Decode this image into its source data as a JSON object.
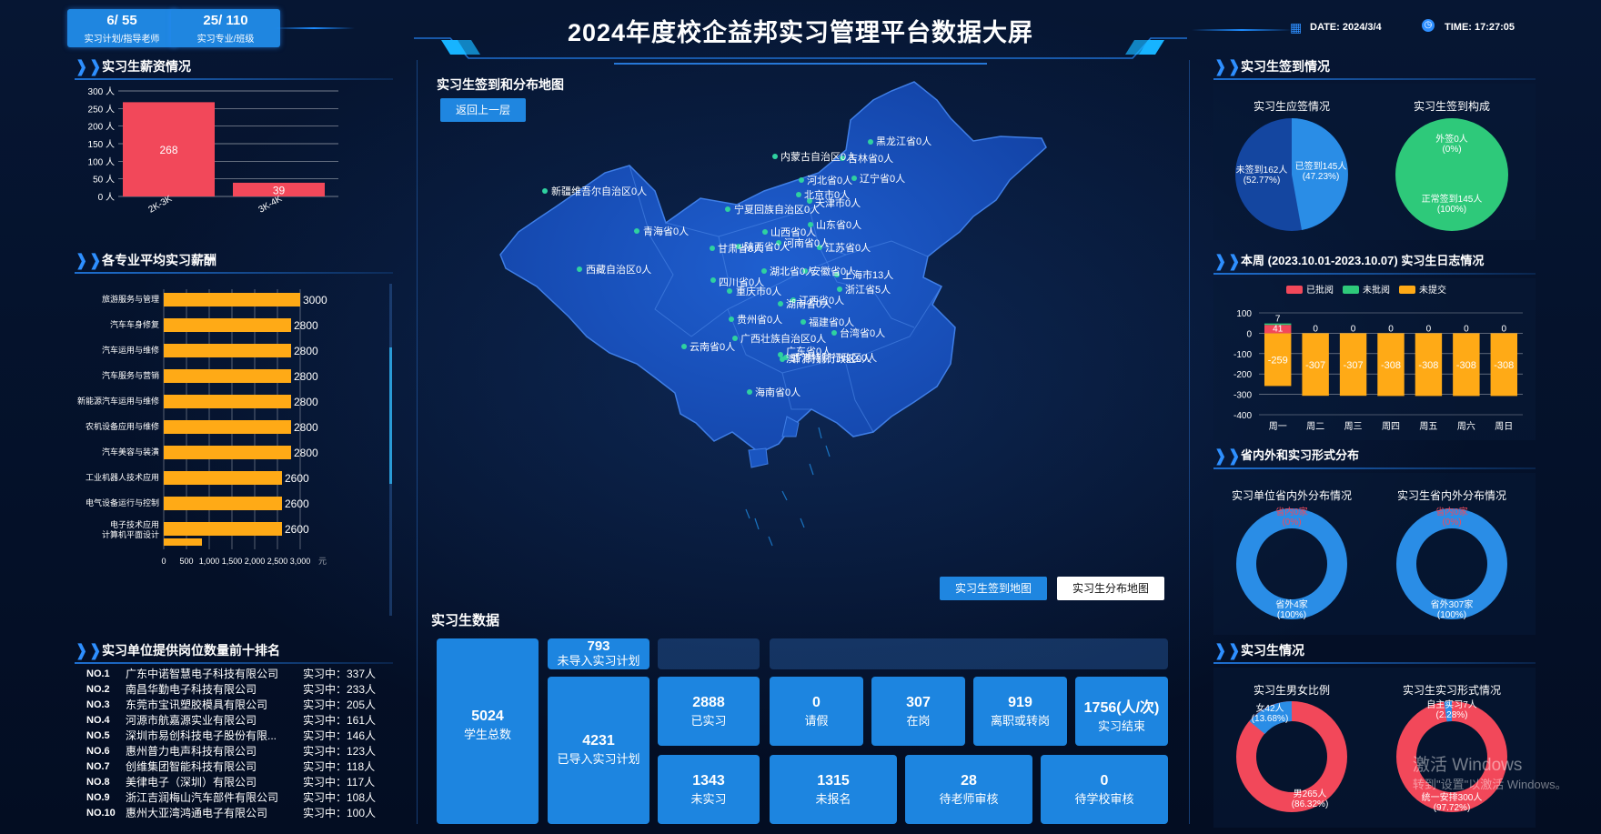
{
  "header": {
    "title": "2024年度校企益邦实习管理平台数据大屏",
    "stats": [
      {
        "value": "6/ 55",
        "label": "实习计划/指导老师"
      },
      {
        "value": "25/ 110",
        "label": "实习专业/班级"
      }
    ],
    "date": "DATE:  2024/3/4",
    "time": "TIME:  17:27:05",
    "colors": {
      "accent": "#1f86e0",
      "bg": "#04122b"
    }
  },
  "salary": {
    "title": "实习生薪资情况",
    "chart_data": {
      "type": "bar",
      "categories": [
        "2K-3K",
        "3K-4K"
      ],
      "values": [
        268,
        39
      ],
      "yticks": [
        "300 人",
        "250 人",
        "200 人",
        "150 人",
        "100 人",
        "50 人",
        "0 人"
      ],
      "ylim": [
        0,
        300
      ],
      "color": "#f2485a"
    }
  },
  "major_salary": {
    "title": "各专业平均实习薪酬",
    "unit": "元",
    "chart_data": {
      "type": "bar",
      "orientation": "horizontal",
      "categories": [
        "旅游服务与管理",
        "汽车车身修复",
        "汽车运用与维修",
        "汽车服务与营销",
        "新能源汽车运用与维修",
        "农机设备应用与维修",
        "汽车美容与装潢",
        "工业机器人技术应用",
        "电气设备运行与控制",
        "电子技术应用",
        "计算机平面设计"
      ],
      "values": [
        3000,
        2800,
        2800,
        2800,
        2800,
        2800,
        2800,
        2600,
        2600,
        2600,
        null
      ],
      "value_labels": [
        "3000",
        "2800",
        "2800",
        "2800",
        "2800",
        "2800",
        "2800",
        "2600",
        "2600",
        "2600"
      ],
      "xticks": [
        "0",
        "500",
        "1,000",
        "1,500",
        "2,000",
        "2,500",
        "3,000"
      ],
      "xlim": [
        0,
        3000
      ],
      "color": "#ffaa16"
    }
  },
  "ranking": {
    "title": "实习单位提供岗位数量前十排名",
    "rows": [
      {
        "no": "NO.1",
        "name": "广东中诺智慧电子科技有限公司",
        "count": "实习中：337人"
      },
      {
        "no": "NO.2",
        "name": "南昌华勤电子科技有限公司",
        "count": "实习中：233人"
      },
      {
        "no": "NO.3",
        "name": "东莞市宝讯塑胶模具有限公司",
        "count": "实习中：205人"
      },
      {
        "no": "NO.4",
        "name": "河源市航嘉源实业有限公司",
        "count": "实习中：161人"
      },
      {
        "no": "NO.5",
        "name": "深圳市易创科技电子股份有限...",
        "count": "实习中：146人"
      },
      {
        "no": "NO.6",
        "name": "惠州普力电声科技有限公司",
        "count": "实习中：123人"
      },
      {
        "no": "NO.7",
        "name": "创维集团智能科技有限公司",
        "count": "实习中：118人"
      },
      {
        "no": "NO.8",
        "name": "美律电子（深圳）有限公司",
        "count": "实习中：117人"
      },
      {
        "no": "NO.9",
        "name": "浙江吉润梅山汽车部件有限公司",
        "count": "实习中：108人"
      },
      {
        "no": "NO.10",
        "name": "惠州大亚湾鸿通电子有限公司",
        "count": "实习中：100人"
      }
    ]
  },
  "map": {
    "title": "实习生签到和分布地图",
    "back_button": "返回上一层",
    "tab_signin": "实习生签到地图",
    "tab_distribution": "实习生分布地图",
    "labels": [
      "黑龙江省0人",
      "吉林省0人",
      "内蒙古自治区0人",
      "辽宁省0人",
      "河北省0人",
      "北京市0人",
      "天津市0人",
      "新疆维吾尔自治区0人",
      "宁夏回族自治区0人",
      "山东省0人",
      "青海省0人",
      "山西省0人",
      "河南省0人",
      "甘肃省0人",
      "陕西省0人",
      "江苏省0人",
      "西藏自治区0人",
      "湖北省0人",
      "安徽省0人",
      "上海市13人",
      "四川省0人",
      "浙江省5人",
      "重庆市0人",
      "江西省0人",
      "湖南省0人",
      "贵州省0人",
      "福建省0人",
      "广西壮族自治区0人",
      "台湾省0人",
      "云南省0人",
      "广东省0人",
      "澳门特别行政区0人",
      "香港特别行政区0人",
      "海南省0人"
    ]
  },
  "student_data": {
    "title": "实习生数据",
    "total": {
      "value": "5024",
      "label": "学生总数"
    },
    "not_imported": {
      "value": "793",
      "label": "未导入实习计划"
    },
    "imported": {
      "value": "4231",
      "label": "已导入实习计划"
    },
    "cards_row1": [
      {
        "value": "2888",
        "label": "已实习"
      },
      {
        "value": "0",
        "label": "请假"
      },
      {
        "value": "307",
        "label": "在岗"
      },
      {
        "value": "919",
        "label": "离职或转岗"
      },
      {
        "value": "1756(人/次)",
        "label": "实习结束"
      }
    ],
    "cards_row2": [
      {
        "value": "1343",
        "label": "未实习"
      },
      {
        "value": "1315",
        "label": "未报名"
      },
      {
        "value": "28",
        "label": "待老师审核"
      },
      {
        "value": "0",
        "label": "待学校审核"
      }
    ]
  },
  "signin": {
    "title": "实习生签到情况",
    "pie1_title": "实习生应签情况",
    "pie1_labels": [
      "未签到162人",
      "(52.77%)",
      "已签到145人",
      "(47.23%)"
    ],
    "pie1_data": {
      "type": "pie",
      "slices": [
        {
          "name": "未签到",
          "value": 162,
          "pct": 52.77,
          "color": "#1446a0"
        },
        {
          "name": "已签到",
          "value": 145,
          "pct": 47.23,
          "color": "#2a8de6"
        }
      ]
    },
    "pie2_title": "实习生签到构成",
    "pie2_labels": [
      "外签0人",
      "(0%)",
      "正常签到145人",
      "(100%)"
    ],
    "pie2_data": {
      "type": "pie",
      "slices": [
        {
          "name": "外签",
          "value": 0,
          "pct": 0
        },
        {
          "name": "正常签到",
          "value": 145,
          "pct": 100,
          "color": "#2ec97a"
        }
      ]
    }
  },
  "weekly_log": {
    "title": "本周 (2023.10.01-2023.10.07) 实习生日志情况",
    "legend": [
      "已批阅",
      "未批阅",
      "未提交"
    ],
    "colors": [
      "#f2485a",
      "#2ec97a",
      "#ffaa16"
    ],
    "chart_data": {
      "type": "bar",
      "categories": [
        "周一",
        "周二",
        "周三",
        "周四",
        "周五",
        "周六",
        "周日"
      ],
      "series": [
        {
          "name": "已批阅",
          "values": [
            41,
            0,
            0,
            0,
            0,
            0,
            0
          ]
        },
        {
          "name": "未批阅",
          "values": [
            7,
            0,
            0,
            0,
            0,
            0,
            0
          ]
        },
        {
          "name": "未提交",
          "values": [
            -259,
            -307,
            -307,
            -308,
            -308,
            -308,
            -308
          ]
        }
      ],
      "top_labels": [
        "7",
        "0",
        "0",
        "0",
        "0",
        "0",
        "0"
      ],
      "mid_labels": [
        "41",
        "",
        "",
        "",
        "",
        "",
        ""
      ],
      "neg_labels": [
        "-259",
        "-307",
        "-307",
        "-308",
        "-308",
        "-308",
        "-308"
      ],
      "yticks": [
        "100",
        "0",
        "-100",
        "-200",
        "-300",
        "-400"
      ],
      "ylim": [
        -400,
        100
      ]
    }
  },
  "province": {
    "title": "省内外和实习形式分布",
    "donut1_title": "实习单位省内外分布情况",
    "donut1_labels": [
      "省内0家",
      "(0%)",
      "省外4家",
      "(100%)"
    ],
    "donut1_data": {
      "type": "pie",
      "slices": [
        {
          "name": "省内",
          "value": 0,
          "pct": 0
        },
        {
          "name": "省外",
          "value": 4,
          "pct": 100,
          "color": "#2a8de6"
        }
      ]
    },
    "donut2_title": "实习生省内外分布情况",
    "donut2_labels": [
      "省内0家",
      "(0%)",
      "省外307家",
      "(100%)"
    ],
    "donut2_data": {
      "type": "pie",
      "slices": [
        {
          "name": "省内",
          "value": 0,
          "pct": 0
        },
        {
          "name": "省外",
          "value": 307,
          "pct": 100,
          "color": "#2a8de6"
        }
      ]
    }
  },
  "student_info": {
    "title": "实习生情况",
    "donut1_title": "实习生男女比例",
    "donut1_labels": [
      "女42人",
      "(13.68%)",
      "男265人",
      "(86.32%)"
    ],
    "donut1_data": {
      "type": "pie",
      "slices": [
        {
          "name": "女",
          "value": 42,
          "pct": 13.68,
          "color": "#2a8de6"
        },
        {
          "name": "男",
          "value": 265,
          "pct": 86.32,
          "color": "#f2485a"
        }
      ]
    },
    "donut2_title": "实习生实习形式情况",
    "donut2_labels": [
      "自主实习7人",
      "(2.28%)",
      "统一安排300人",
      "(97.72%)"
    ],
    "donut2_data": {
      "type": "pie",
      "slices": [
        {
          "name": "自主实习",
          "value": 7,
          "pct": 2.28,
          "color": "#2a8de6"
        },
        {
          "name": "统一安排",
          "value": 300,
          "pct": 97.72,
          "color": "#f2485a"
        }
      ]
    }
  },
  "windows_watermark": {
    "line1": "激活 Windows",
    "line2": "转到\"设置\"以激活 Windows。"
  }
}
